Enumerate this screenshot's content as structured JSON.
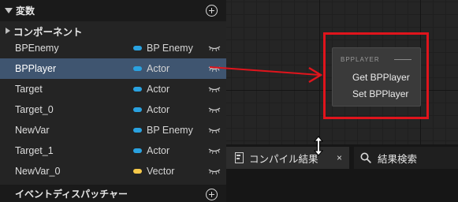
{
  "variables_section": {
    "title": "変数",
    "add_icon": "plus-circle-icon"
  },
  "components": {
    "title": "コンポーネント"
  },
  "variables": [
    {
      "name": "BPEnemy",
      "type": "BP Enemy",
      "type_color": "#2aa2e0",
      "selected": false
    },
    {
      "name": "BPPlayer",
      "type": "Actor",
      "type_color": "#2aa2e0",
      "selected": true
    },
    {
      "name": "Target",
      "type": "Actor",
      "type_color": "#2aa2e0",
      "selected": false
    },
    {
      "name": "Target_0",
      "type": "Actor",
      "type_color": "#2aa2e0",
      "selected": false
    },
    {
      "name": "NewVar",
      "type": "BP Enemy",
      "type_color": "#2aa2e0",
      "selected": false
    },
    {
      "name": "Target_1",
      "type": "Actor",
      "type_color": "#2aa2e0",
      "selected": false
    },
    {
      "name": "NewVar_0",
      "type": "Vector",
      "type_color": "#f6c94a",
      "selected": false
    }
  ],
  "event_dispatchers": {
    "title": "イベントディスパッチャー",
    "add_icon": "plus-circle-icon"
  },
  "context_menu": {
    "title": "BPPLAYER",
    "items": [
      "Get BPPlayer",
      "Set BPPlayer"
    ]
  },
  "tabs": {
    "compile_results": {
      "label": "コンパイル結果",
      "close": "×"
    },
    "find_results": {
      "label": "結果検索"
    }
  },
  "colors": {
    "highlight_red": "#e0141c",
    "selection_blue": "#3f5570"
  }
}
